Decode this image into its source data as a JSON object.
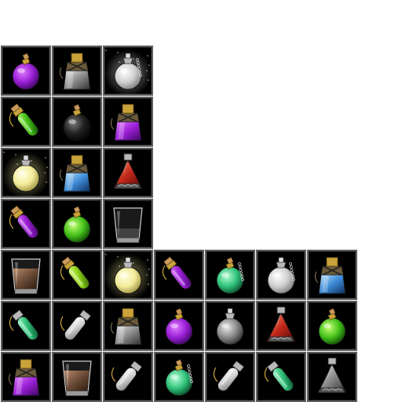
{
  "inventory": {
    "colors": {
      "slot_background": "#000000",
      "slot_border": "#5e5e5e",
      "page_background": "#ffffff"
    },
    "rows": [
      [
        "round-flask-purple-icon",
        "bottle-gray-icon",
        "round-flask-white-glow-icon"
      ],
      [
        "vial-green-icon",
        "round-flask-black-icon",
        "bottle-purple-icon"
      ],
      [
        "round-flask-yellow-glow-icon",
        "bottle-blue-icon",
        "triangle-flask-red-icon"
      ],
      [
        "vial-purple-icon",
        "round-flask-green-icon",
        "glass-empty-icon"
      ],
      [
        "glass-brown-icon",
        "vial-lime-icon",
        "round-flask-yellow-glow-icon",
        "vial-purple-icon",
        "round-flask-teal-icon",
        "round-flask-white-icon",
        "bottle-blue-icon"
      ],
      [
        "vial-teal-icon",
        "vial-white-icon",
        "bottle-gray-icon",
        "round-flask-purple-icon",
        "round-flask-gray-icon",
        "triangle-flask-red-icon",
        "round-flask-green-icon"
      ],
      [
        "bottle-purple-icon",
        "glass-brown-icon",
        "vial-white-icon",
        "round-flask-teal-icon",
        "vial-white-icon",
        "vial-teal-icon",
        "triangle-flask-gray-icon"
      ]
    ]
  }
}
